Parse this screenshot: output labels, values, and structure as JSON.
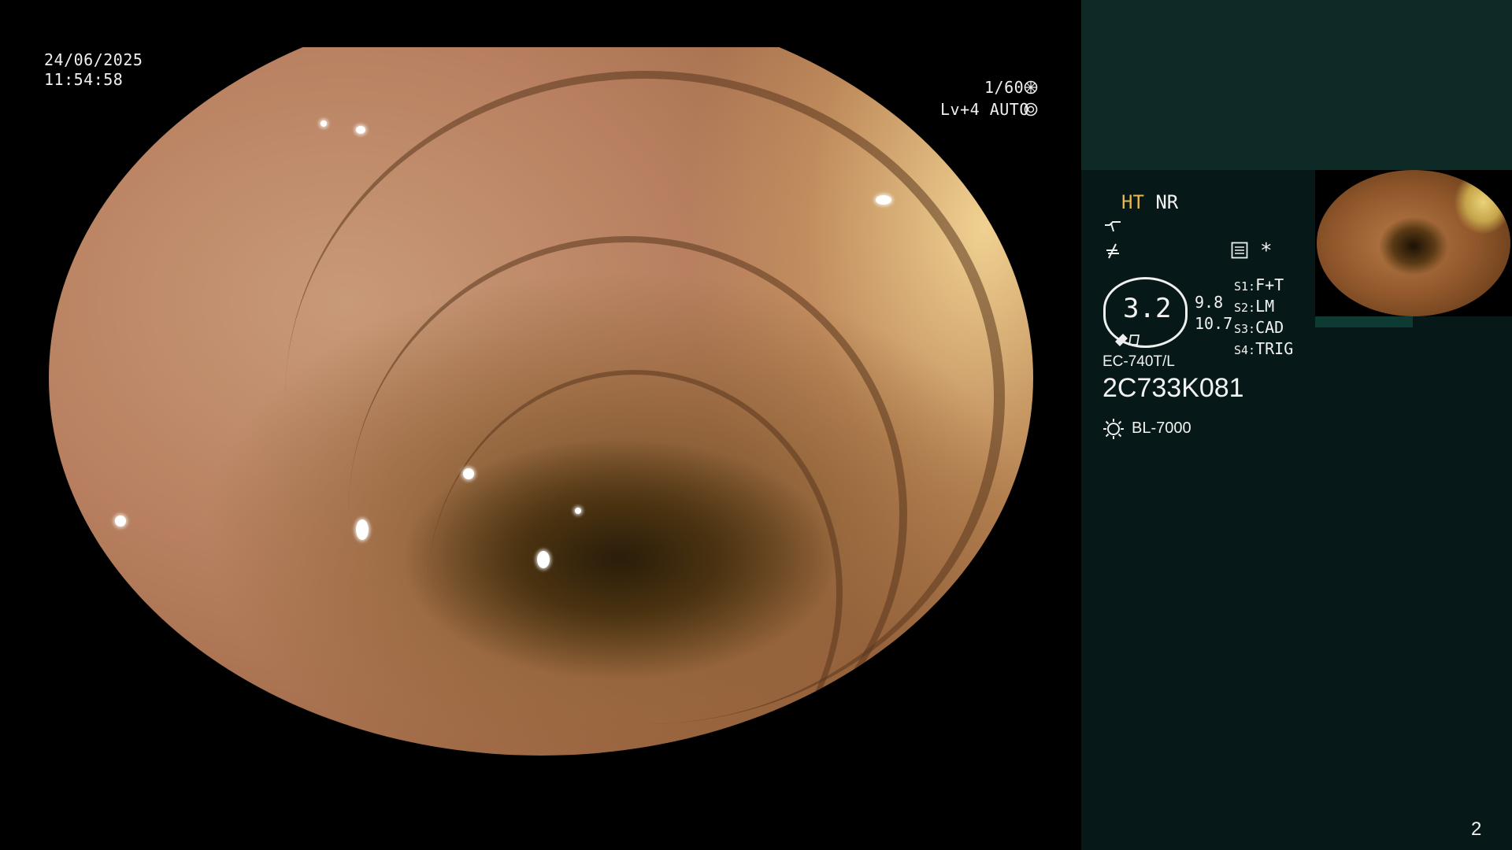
{
  "left_overlay": {
    "date": "24/06/2025",
    "time": "11:54:58",
    "shutter": "1/60",
    "level": "Lv+4 AUTO"
  },
  "icons": {
    "shutter_icon": "aperture-icon",
    "auto_icon": "iris-icon",
    "curve_icon": "curve-icon",
    "freeze_icon": "freeze-icon",
    "settings_icon": "settings-panel-icon",
    "light_icon": "light-source-icon"
  },
  "panel": {
    "mode_ht": "HT",
    "mode_nr": "NR",
    "star": "*",
    "zoom_value": "3.2",
    "distance_1": "9.8",
    "distance_2": "10.7",
    "switches": [
      {
        "key": "S1:",
        "value": "F+T"
      },
      {
        "key": "S2:",
        "value": "LM"
      },
      {
        "key": "S3:",
        "value": "CAD"
      },
      {
        "key": "S4:",
        "value": "TRIG"
      }
    ],
    "scope_model": "EC-740T/L",
    "serial": "2C733K081",
    "light_source": "BL-7000",
    "page_number": "2"
  },
  "colors": {
    "panel_top": "#0d2a27",
    "panel_body": "#061918",
    "accent_yellow": "#e9b84a"
  }
}
